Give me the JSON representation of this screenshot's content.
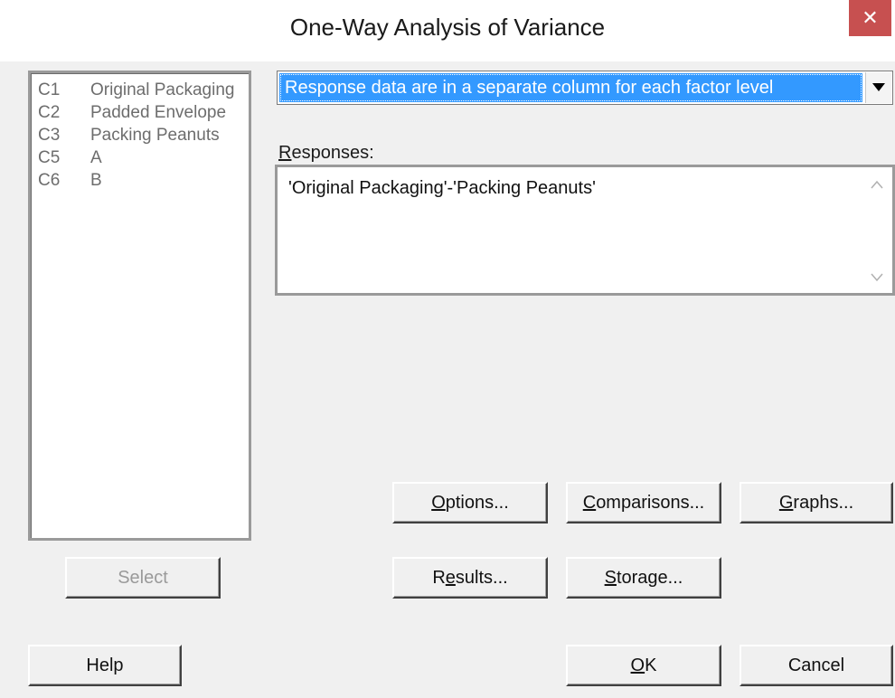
{
  "window": {
    "title": "One-Way Analysis of Variance",
    "close_glyph": "✕"
  },
  "variables": [
    {
      "col": "C1",
      "name": "Original Packaging"
    },
    {
      "col": "C2",
      "name": "Padded Envelope"
    },
    {
      "col": "C3",
      "name": "Packing Peanuts"
    },
    {
      "col": "C5",
      "name": "A"
    },
    {
      "col": "C6",
      "name": "B"
    }
  ],
  "data_layout": {
    "selected": "Response data are in a separate column for each factor level"
  },
  "responses": {
    "label_prefix": "R",
    "label_rest": "esponses:",
    "value": "'Original Packaging'-'Packing Peanuts'"
  },
  "buttons": {
    "options": {
      "before": "",
      "key": "O",
      "after": "ptions..."
    },
    "comparisons": {
      "before": "",
      "key": "C",
      "after": "omparisons..."
    },
    "graphs": {
      "before": "",
      "key": "G",
      "after": "raphs..."
    },
    "results": {
      "before": "R",
      "key": "e",
      "after": "sults..."
    },
    "storage": {
      "before": "",
      "key": "S",
      "after": "torage..."
    },
    "select": "Select",
    "help": "Help",
    "ok": {
      "key": "O",
      "after": "K"
    },
    "cancel": "Cancel"
  },
  "colors": {
    "selection": "#3399ff",
    "close_button": "#c75050",
    "dialog_bg": "#f0f0f0"
  }
}
